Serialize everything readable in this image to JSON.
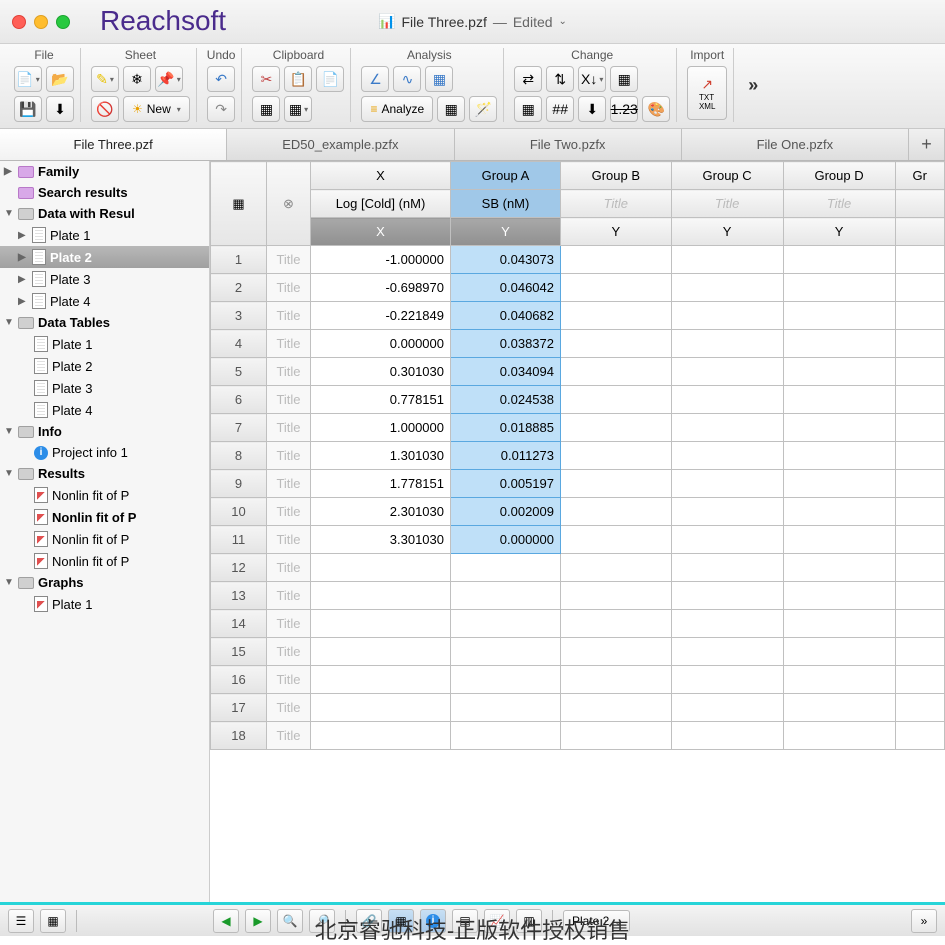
{
  "watermarks": {
    "top": "Reachsoft",
    "bottom": "北京睿驰科技-正版软件授权销售"
  },
  "window": {
    "filename": "File Three.pzf",
    "status": "Edited"
  },
  "toolbar": {
    "groups": {
      "file": "File",
      "sheet": "Sheet",
      "undo": "Undo",
      "clipboard": "Clipboard",
      "analysis": "Analysis",
      "change": "Change",
      "import": "Import"
    },
    "new_label": "New",
    "analyze_label": "Analyze"
  },
  "doc_tabs": [
    "File Three.pzf",
    "ED50_example.pzfx",
    "File Two.pzfx",
    "File One.pzfx"
  ],
  "active_doc_tab": 0,
  "sidebar": {
    "family": "Family",
    "search": "Search results",
    "data_with_results": "Data with Resul",
    "plates_dr": [
      "Plate 1",
      "Plate 2",
      "Plate 3",
      "Plate 4"
    ],
    "data_tables": "Data Tables",
    "plates_dt": [
      "Plate 1",
      "Plate 2",
      "Plate 3",
      "Plate 4"
    ],
    "info": "Info",
    "project_info": "Project info 1",
    "results": "Results",
    "nonlin": [
      "Nonlin fit of P",
      "Nonlin fit of P",
      "Nonlin fit of P",
      "Nonlin fit of P"
    ],
    "graphs": "Graphs",
    "graph_items": [
      "Plate 1"
    ]
  },
  "table": {
    "col_headers_top": [
      "X",
      "Group A",
      "Group B",
      "Group C",
      "Group D",
      "Gr"
    ],
    "col_headers_mid": [
      "Log [Cold] (nM)",
      "SB (nM)",
      "Title",
      "Title",
      "Title",
      ""
    ],
    "col_headers_bot": [
      "X",
      "Y",
      "Y",
      "Y",
      "Y",
      ""
    ],
    "rows": [
      {
        "x": "-1.000000",
        "y": "0.043073"
      },
      {
        "x": "-0.698970",
        "y": "0.046042"
      },
      {
        "x": "-0.221849",
        "y": "0.040682"
      },
      {
        "x": "0.000000",
        "y": "0.038372"
      },
      {
        "x": "0.301030",
        "y": "0.034094"
      },
      {
        "x": "0.778151",
        "y": "0.024538"
      },
      {
        "x": "1.000000",
        "y": "0.018885"
      },
      {
        "x": "1.301030",
        "y": "0.011273"
      },
      {
        "x": "1.778151",
        "y": "0.005197"
      },
      {
        "x": "2.301030",
        "y": "0.002009"
      },
      {
        "x": "3.301030",
        "y": "0.000000"
      }
    ],
    "empty_row_count": 7,
    "title_placeholder": "Title"
  },
  "statusbar": {
    "nav_label": "Plate 2"
  }
}
